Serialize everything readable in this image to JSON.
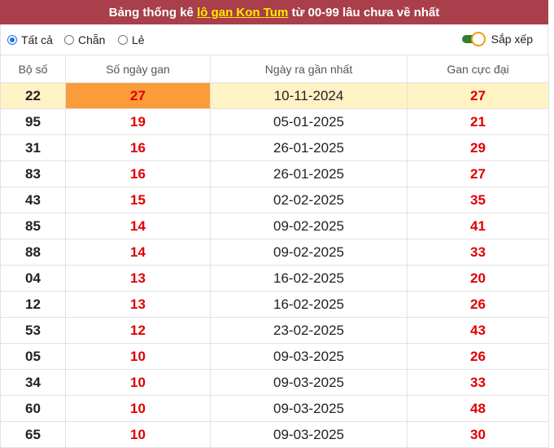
{
  "banner": {
    "prefix": "Bảng thống kê",
    "link": "lô gan Kon Tum",
    "suffix": "từ 00-99 lâu chưa về nhất"
  },
  "filters": {
    "options": [
      "Tất cả",
      "Chẵn",
      "Lẻ"
    ],
    "selected": "Tất cả",
    "sort_label": "Sắp xếp",
    "sort_on": true
  },
  "colors": {
    "banner": "#a83f4a",
    "link": "#ffea00",
    "value_red": "#e00000",
    "highlight_row": "#fff2c4",
    "highlight_cell": "#fb9c3a",
    "toggle": "#2e7d32"
  },
  "table": {
    "headers": [
      "Bộ số",
      "Số ngày gan",
      "Ngày ra gần nhất",
      "Gan cực đại"
    ],
    "rows": [
      {
        "so": "22",
        "gan": "27",
        "date": "10-11-2024",
        "max": "27"
      },
      {
        "so": "95",
        "gan": "19",
        "date": "05-01-2025",
        "max": "21"
      },
      {
        "so": "31",
        "gan": "16",
        "date": "26-01-2025",
        "max": "29"
      },
      {
        "so": "83",
        "gan": "16",
        "date": "26-01-2025",
        "max": "27"
      },
      {
        "so": "43",
        "gan": "15",
        "date": "02-02-2025",
        "max": "35"
      },
      {
        "so": "85",
        "gan": "14",
        "date": "09-02-2025",
        "max": "41"
      },
      {
        "so": "88",
        "gan": "14",
        "date": "09-02-2025",
        "max": "33"
      },
      {
        "so": "04",
        "gan": "13",
        "date": "16-02-2025",
        "max": "20"
      },
      {
        "so": "12",
        "gan": "13",
        "date": "16-02-2025",
        "max": "26"
      },
      {
        "so": "53",
        "gan": "12",
        "date": "23-02-2025",
        "max": "43"
      },
      {
        "so": "05",
        "gan": "10",
        "date": "09-03-2025",
        "max": "26"
      },
      {
        "so": "34",
        "gan": "10",
        "date": "09-03-2025",
        "max": "33"
      },
      {
        "so": "60",
        "gan": "10",
        "date": "09-03-2025",
        "max": "48"
      },
      {
        "so": "65",
        "gan": "10",
        "date": "09-03-2025",
        "max": "30"
      }
    ]
  }
}
